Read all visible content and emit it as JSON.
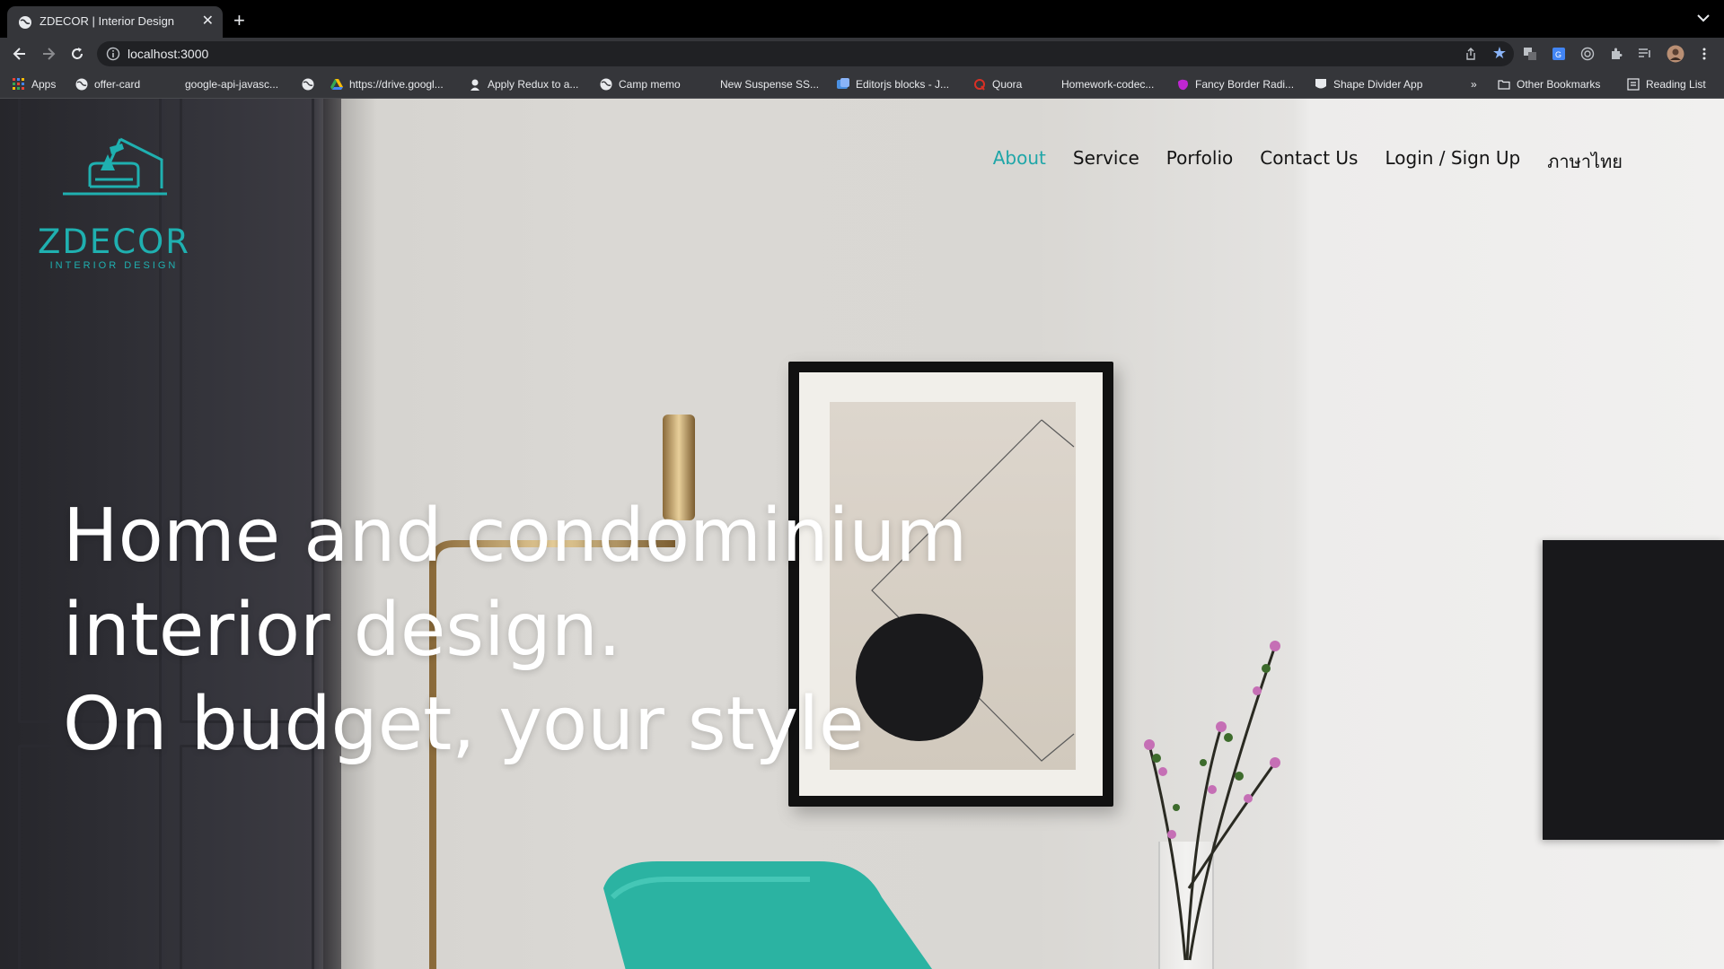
{
  "browser": {
    "tab": {
      "title": "ZDECOR | Interior Design",
      "close": "✕"
    },
    "new_tab": "+",
    "url": "localhost:3000",
    "bookmarks": [
      {
        "label": "Apps",
        "icon": "apps-grid-icon"
      },
      {
        "label": "offer-card",
        "icon": "globe-icon"
      },
      {
        "label": "google-api-javasc...",
        "icon": "none"
      },
      {
        "label": "",
        "icon": "globe-icon"
      },
      {
        "label": "https://drive.googl...",
        "icon": "drive-icon"
      },
      {
        "label": "Apply Redux to a...",
        "icon": "avatar-icon"
      },
      {
        "label": "Camp memo",
        "icon": "globe-icon"
      },
      {
        "label": "New Suspense SS...",
        "icon": "none"
      },
      {
        "label": "Editorjs blocks - J...",
        "icon": "editorjs-icon"
      },
      {
        "label": "Quora",
        "icon": "quora-icon"
      },
      {
        "label": "Homework-codec...",
        "icon": "none"
      },
      {
        "label": "Fancy Border Radi...",
        "icon": "fancy-border-icon"
      },
      {
        "label": "Shape Divider App",
        "icon": "shape-divider-icon"
      }
    ],
    "more_bookmarks": "»",
    "other_bookmarks": "Other Bookmarks",
    "reading_list": "Reading List"
  },
  "site": {
    "logo": {
      "word": "ZDECOR",
      "tagline": "INTERIOR DESIGN"
    },
    "nav": [
      {
        "label": "About",
        "active": true
      },
      {
        "label": "Service",
        "active": false
      },
      {
        "label": "Porfolio",
        "active": false
      },
      {
        "label": "Contact Us",
        "active": false
      },
      {
        "label": "Login / Sign Up",
        "active": false
      },
      {
        "label": "ภาษาไทย",
        "active": false
      }
    ],
    "hero": {
      "line1": "Home and condominium",
      "line2": "interior design.",
      "line3": "On budget, your style"
    }
  },
  "colors": {
    "brand_teal": "#1fb0b0",
    "nav_active": "#1fa6a8",
    "nav_text": "#141414",
    "hero_text": "#ffffff"
  }
}
